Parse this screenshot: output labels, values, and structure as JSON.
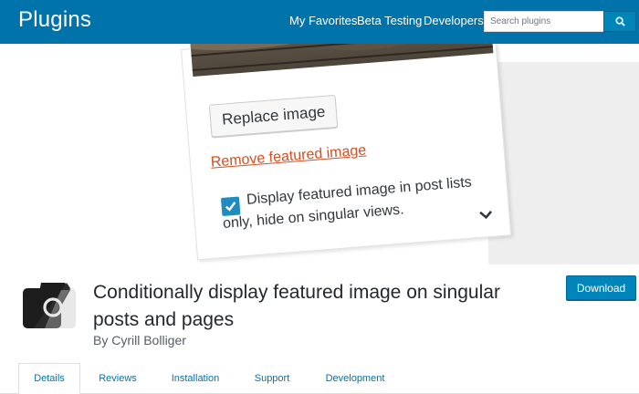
{
  "header": {
    "title": "Plugins",
    "nav": [
      "My Favorites",
      "Beta Testing",
      "Developers"
    ],
    "search_placeholder": "Search plugins",
    "search_icon": "search-icon"
  },
  "banner": {
    "replace_button": "Replace image",
    "remove_link": "Remove featured image",
    "checkbox_checked": true,
    "checkbox_text_line1": "Display featured image in post lists",
    "checkbox_text_line2": "only, hide on singular views."
  },
  "plugin": {
    "title": "Conditionally display featured image on singular posts and pages",
    "author": "By Cyrill Bolliger",
    "download_label": "Download"
  },
  "tabs": [
    "Details",
    "Reviews",
    "Installation",
    "Support",
    "Development"
  ],
  "active_tab": "Details",
  "colors": {
    "header": "#0073aa",
    "button": "#0085ba",
    "link": "#0073aa",
    "remove_link": "#d54e21",
    "checkbox": "#1e8cbe"
  }
}
